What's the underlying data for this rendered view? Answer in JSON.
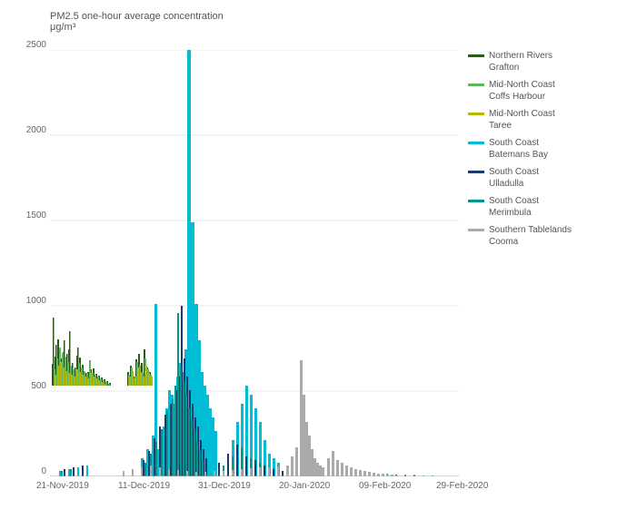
{
  "chart": {
    "title_line1": "PM2.5 one-hour average concentration",
    "title_line2": "μg/m³",
    "x_labels": [
      "21-Nov-2019",
      "11-Dec-2019",
      "31-Dec-2019",
      "20-Jan-2020",
      "09-Feb-2020",
      "29-Feb-2020"
    ],
    "y_labels": [
      "0",
      "500",
      "1000",
      "1500",
      "2000",
      "2500"
    ],
    "y_max": 2500
  },
  "legend": {
    "items": [
      {
        "label": "Northern Rivers\nGrafton",
        "color": "#2d5a1b"
      },
      {
        "label": "Mid-North Coast\nCoffs Harbour",
        "color": "#5cb85c"
      },
      {
        "label": "Mid-North Coast\nTaree",
        "color": "#b5b800"
      },
      {
        "label": "South Coast\nBatemans Bay",
        "color": "#00bcd4"
      },
      {
        "label": "South Coast\nUlladulla",
        "color": "#1a3a6e"
      },
      {
        "label": "South Coast\nMerimbula",
        "color": "#009688"
      },
      {
        "label": "Southern Tablelands\nCooma",
        "color": "#aaaaaa"
      }
    ]
  }
}
